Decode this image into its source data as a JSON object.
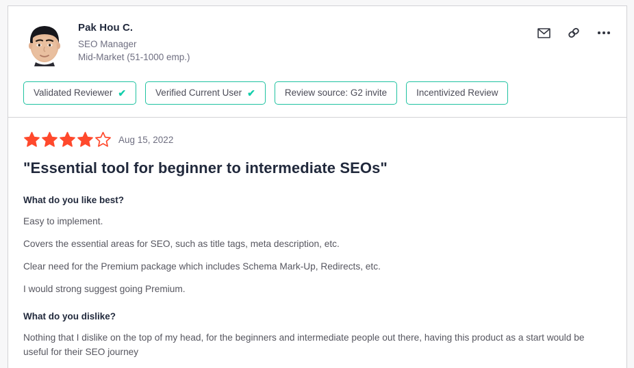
{
  "colors": {
    "star_filled": "#FF492C",
    "badge_border": "#1EC2A0",
    "check": "#13CEAB",
    "title_text": "#21293C",
    "body_text": "#56565F",
    "muted_text": "#6E6E80",
    "card_border": "#D2D2D5",
    "page_background": "#F7F7F8"
  },
  "reviewer": {
    "name": "Pak Hou C.",
    "role": "SEO Manager",
    "company_size": "Mid-Market (51-1000 emp.)",
    "avatar_alt": "Pak Hou C. profile photo"
  },
  "header_actions": [
    {
      "name": "email-icon",
      "label": "Email review"
    },
    {
      "name": "link-icon",
      "label": "Copy link to review"
    },
    {
      "name": "more-options-icon",
      "label": "More options"
    }
  ],
  "badges": [
    {
      "label": "Validated Reviewer",
      "checked": true,
      "check_glyph": "✔"
    },
    {
      "label": "Verified Current User",
      "checked": true,
      "check_glyph": "✔"
    },
    {
      "label": "Review source: G2 invite",
      "checked": false,
      "check_glyph": ""
    },
    {
      "label": "Incentivized Review",
      "checked": false,
      "check_glyph": ""
    }
  ],
  "review": {
    "rating": 4,
    "rating_max": 5,
    "date": "Aug 15, 2022",
    "title": "\"Essential tool for beginner to intermediate SEOs\"",
    "sections": [
      {
        "question": "What do you like best?",
        "paragraphs": [
          "Easy to implement.",
          "Covers the essential areas for SEO, such as title tags, meta description, etc.",
          "Clear need for the Premium package which includes Schema Mark-Up, Redirects, etc.",
          "I would strong suggest going Premium."
        ]
      },
      {
        "question": "What do you dislike?",
        "paragraphs": [
          "Nothing that I dislike on the top of my head, for the beginners and intermediate people out there, having this product as a start would be useful for their SEO journey"
        ]
      }
    ]
  }
}
